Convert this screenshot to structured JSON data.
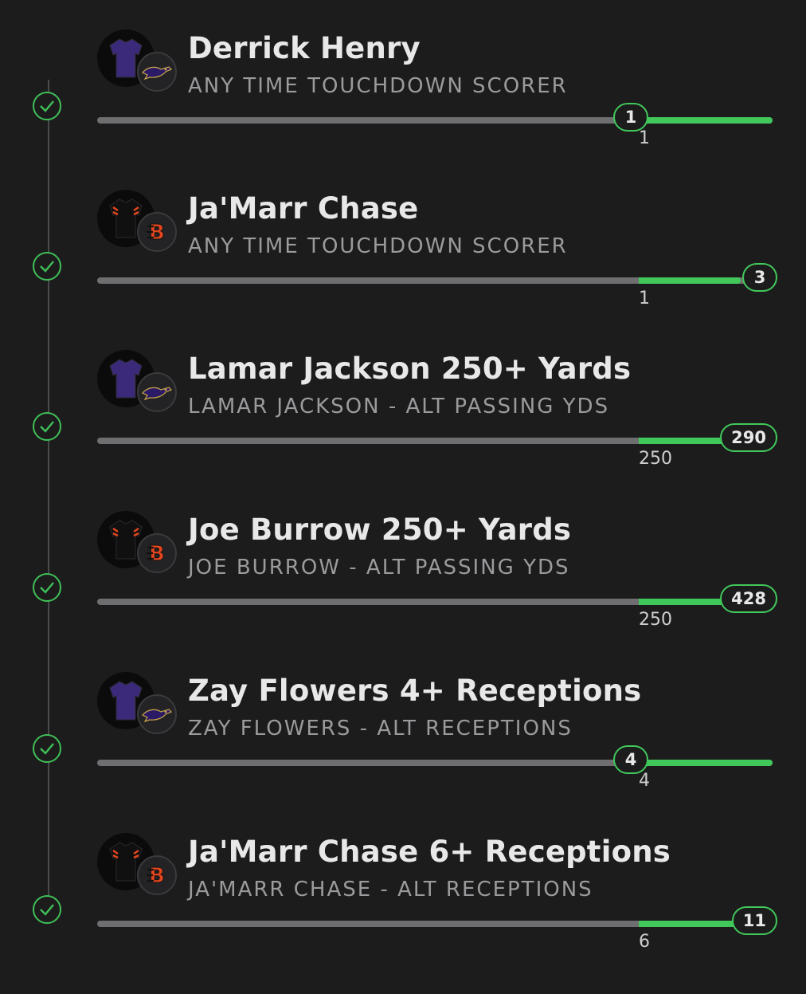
{
  "colors": {
    "background": "#1c1c1d",
    "accent": "#41c85a",
    "track": "#6e6e70",
    "ravens": "#3b2a7a",
    "bengals_orange": "#e3461e"
  },
  "legs": [
    {
      "title": "Derrick Henry",
      "subtitle": "ANY TIME TOUCHDOWN SCORER",
      "team": "ravens",
      "line": "1",
      "actual": "1",
      "progress": 1.0,
      "status_icon": "check-circle-icon"
    },
    {
      "title": "Ja'Marr Chase",
      "subtitle": "ANY TIME TOUCHDOWN SCORER",
      "team": "bengals",
      "line": "1",
      "actual": "3",
      "progress": 3.0,
      "status_icon": "check-circle-icon"
    },
    {
      "title": "Lamar Jackson 250+ Yards",
      "subtitle": "LAMAR JACKSON - ALT PASSING YDS",
      "team": "ravens",
      "line": "250",
      "actual": "290",
      "progress": 1.16,
      "status_icon": "check-circle-icon"
    },
    {
      "title": "Joe Burrow 250+ Yards",
      "subtitle": "JOE BURROW - ALT PASSING YDS",
      "team": "bengals",
      "line": "250",
      "actual": "428",
      "progress": 1.71,
      "status_icon": "check-circle-icon"
    },
    {
      "title": "Zay Flowers 4+ Receptions",
      "subtitle": "ZAY FLOWERS - ALT RECEPTIONS",
      "team": "ravens",
      "line": "4",
      "actual": "4",
      "progress": 1.0,
      "status_icon": "check-circle-icon"
    },
    {
      "title": "Ja'Marr Chase 6+ Receptions",
      "subtitle": "JA'MARR CHASE - ALT RECEPTIONS",
      "team": "bengals",
      "line": "6",
      "actual": "11",
      "progress": 1.83,
      "status_icon": "check-circle-icon"
    }
  ]
}
